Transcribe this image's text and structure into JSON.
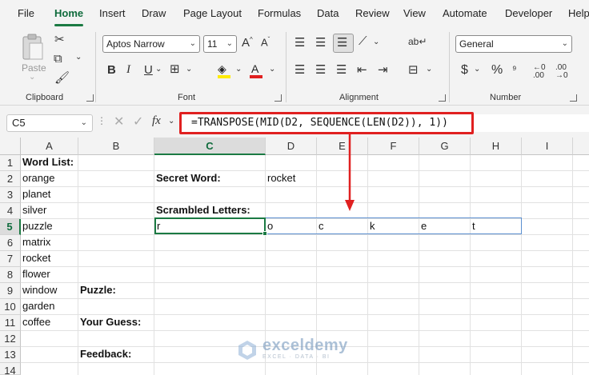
{
  "menu": [
    "File",
    "Home",
    "Insert",
    "Draw",
    "Page Layout",
    "Formulas",
    "Data",
    "Review",
    "View",
    "Automate",
    "Developer",
    "Help"
  ],
  "active_tab": "Home",
  "ribbon": {
    "clipboard": {
      "paste_label": "Paste",
      "group_label": "Clipboard"
    },
    "font": {
      "font_name": "Aptos Narrow",
      "font_size": "11",
      "group_label": "Font"
    },
    "alignment": {
      "group_label": "Alignment"
    },
    "number": {
      "format": "General",
      "group_label": "Number",
      "currency_symbol": "$",
      "percent_symbol": "%"
    }
  },
  "formula_bar": {
    "name_box": "C5",
    "fx": "fx",
    "formula": "=TRANSPOSE(MID(D2, SEQUENCE(LEN(D2)), 1))"
  },
  "sheet": {
    "columns": [
      "A",
      "B",
      "C",
      "D",
      "E",
      "F",
      "G",
      "H",
      "I"
    ],
    "selected_column": "C",
    "rows": [
      "1",
      "2",
      "3",
      "4",
      "5",
      "6",
      "7",
      "8",
      "9",
      "10",
      "11",
      "12",
      "13",
      "14"
    ],
    "selected_row": "5",
    "word_list_header": "Word List:",
    "words": [
      "orange",
      "planet",
      "silver",
      "puzzle",
      "matrix",
      "rocket",
      "flower",
      "window",
      "garden",
      "coffee"
    ],
    "secret_word_label": "Secret Word:",
    "secret_word_value": "rocket",
    "scrambled_label": "Scrambled Letters:",
    "letters": [
      "r",
      "o",
      "c",
      "k",
      "e",
      "t"
    ],
    "puzzle_label": "Puzzle:",
    "guess_label": "Your Guess:",
    "feedback_label": "Feedback:"
  },
  "watermark": {
    "name": "exceldemy",
    "tagline": "EXCEL · DATA · BI"
  },
  "colors": {
    "accent": "#1b7a43",
    "highlight": "#e02020",
    "spill_border": "#5b8fd0"
  }
}
